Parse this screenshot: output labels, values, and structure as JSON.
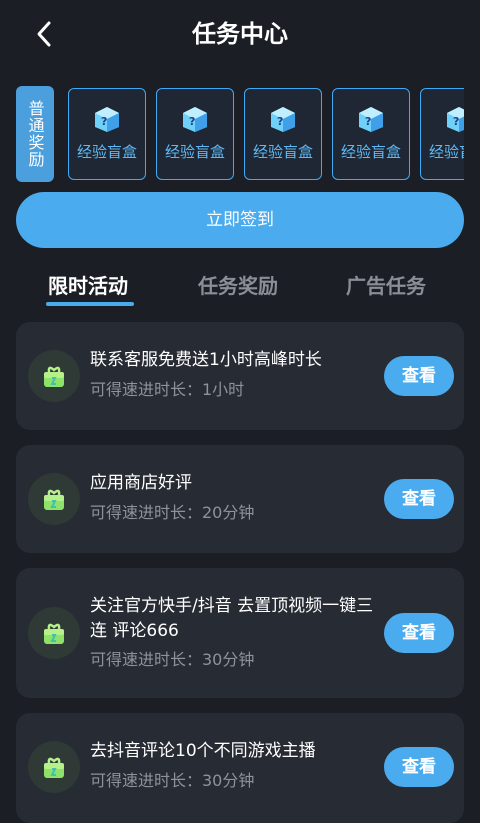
{
  "header": {
    "title": "任务中心"
  },
  "reward_strip": {
    "tag_label": "普通奖励",
    "boxes": [
      {
        "label": "经验盲盒",
        "icon": "mystery-box-icon"
      },
      {
        "label": "经验盲盒",
        "icon": "mystery-box-icon"
      },
      {
        "label": "经验盲盒",
        "icon": "mystery-box-icon"
      },
      {
        "label": "经验盲盒",
        "icon": "mystery-box-icon"
      },
      {
        "label": "经验盲盒",
        "icon": "mystery-box-icon"
      }
    ]
  },
  "checkin": {
    "label": "立即签到"
  },
  "tabs": [
    {
      "label": "限时活动",
      "active": true
    },
    {
      "label": "任务奖励",
      "active": false
    },
    {
      "label": "广告任务",
      "active": false
    }
  ],
  "tasks": [
    {
      "title": "联系客服免费送1小时高峰时长",
      "reward": "可得速进时长：1小时",
      "button": "查看"
    },
    {
      "title": "应用商店好评",
      "reward": "可得速进时长：20分钟",
      "button": "查看"
    },
    {
      "title": "关注官方快手/抖音 去置顶视频一键三连 评论666",
      "reward": "可得速进时长：30分钟",
      "button": "查看"
    },
    {
      "title": "去抖音评论10个不同游戏主播",
      "reward": "可得速进时长：30分钟",
      "button": "查看"
    }
  ],
  "colors": {
    "background": "#1b1e25",
    "card": "#272b33",
    "accent": "#4aacef",
    "box_border": "#3fa9f5",
    "muted_text": "#8e929a"
  }
}
